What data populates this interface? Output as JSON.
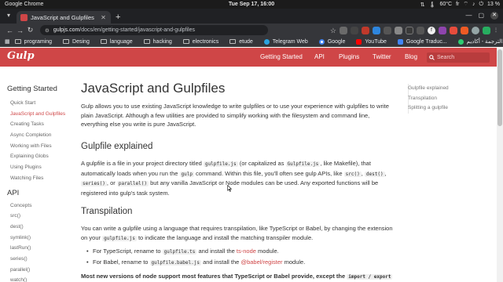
{
  "os": {
    "app": "Google Chrome",
    "clock": "Tue Sep 17, 16:00",
    "temp": "60°C",
    "lang": "fr",
    "battery": "13 %"
  },
  "browser": {
    "tab_title": "JavaScript and Gulpfiles",
    "url_host": "gulpjs.com",
    "url_path": "/docs/en/getting-started/javascript-and-gulpfiles",
    "bookmarks": [
      "programing",
      "Desing",
      "language",
      "hacking",
      "electronics",
      "etude",
      "Telegram Web",
      "Google",
      "YouTube",
      "Google Traduc...",
      "الترجمة - أكاديم..."
    ]
  },
  "header": {
    "logo": "Gulp",
    "nav": [
      "Getting Started",
      "API",
      "Plugins",
      "Twitter",
      "Blog"
    ],
    "search_placeholder": "Search"
  },
  "sidebar": {
    "getting_started_heading": "Getting Started",
    "getting_started_items": [
      "Quick Start",
      "JavaScript and Gulpfiles",
      "Creating Tasks",
      "Async Completion",
      "Working with Files",
      "Explaining Globs",
      "Using Plugins",
      "Watching Files"
    ],
    "api_heading": "API",
    "api_items": [
      "Concepts",
      "src()",
      "dest()",
      "symlink()",
      "lastRun()",
      "series()",
      "parallel()",
      "watch()"
    ]
  },
  "content": {
    "title": "JavaScript and Gulpfiles",
    "intro": "Gulp allows you to use existing JavaScript knowledge to write gulpfiles or to use your experience with gulpfiles to write plain JavaScript. Although a few utilities are provided to simplify working with the filesystem and command line, everything else you write is pure JavaScript.",
    "h_gulpfile": "Gulpfile explained",
    "gp_1": "A gulpfile is a file in your project directory titled",
    "gp_code1": "gulpfile.js",
    "gp_2": "(or capitalized as",
    "gp_code2": "Gulpfile.js",
    "gp_3": ", like Makefile), that automatically loads when you run the",
    "gp_code3": "gulp",
    "gp_4": "command. Within this file, you'll often see gulp APIs, like",
    "gp_code4": "src()",
    "gp_5": ",",
    "gp_code5": "dest()",
    "gp_6": ",",
    "gp_code6": "series()",
    "gp_7": ", or",
    "gp_code7": "parallel()",
    "gp_8": "but any vanilla JavaScript or Node modules can be used. Any exported functions will be registered into gulp's task system.",
    "h_transpilation": "Transpilation",
    "tp_1": "You can write a gulpfile using a language that requires transpilation, like TypeScript or Babel, by changing the extension on your",
    "tp_code1": "gulpfile.js",
    "tp_2": "to indicate the language and install the matching transpiler module.",
    "li1_a": "For TypeScript, rename to",
    "li1_code": "gulpfile.ts",
    "li1_b": "and install the",
    "li1_link": "ts-node",
    "li1_c": "module.",
    "li2_a": "For Babel, rename to",
    "li2_code": "gulpfile.babel.js",
    "li2_b": "and install the",
    "li2_link": "@babel/register",
    "li2_c": "module.",
    "strong_line": "Most new versions of node support most features that TypeScript or Babel provide, except the",
    "strong_code": "import / export"
  },
  "toc": [
    "Gulpfile explained",
    "Transpilation",
    "Splitting a gulpfile"
  ],
  "colors": {
    "brand": "#cf4647",
    "text": "#333333"
  }
}
